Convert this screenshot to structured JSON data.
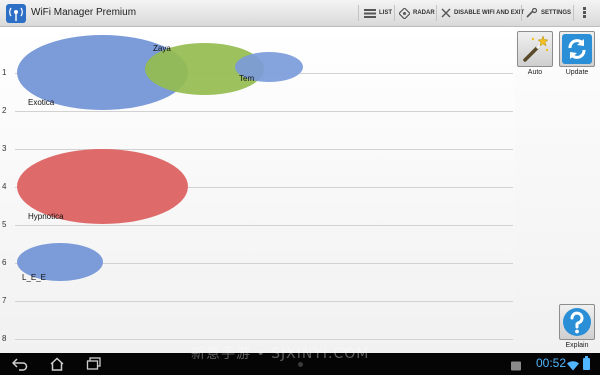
{
  "app": {
    "title": "WiFi Manager Premium",
    "icon": "wifi-antenna-icon"
  },
  "toolbar": {
    "actions": [
      {
        "label": "LIST",
        "icon": "list-icon"
      },
      {
        "label": "RADAR",
        "icon": "radar-icon"
      },
      {
        "label": "DISABLE WIFI AND EXIT",
        "icon": "disable-wifi-icon"
      },
      {
        "label": "SETTINGS",
        "icon": "wrench-icon"
      }
    ],
    "overflow_icon": "overflow-menu-icon"
  },
  "chart_data": {
    "type": "bubble",
    "y_ticks": [
      "1",
      "2",
      "3",
      "4",
      "5",
      "6",
      "7",
      "8"
    ],
    "series": [
      {
        "name": "Exotica",
        "x": 0.17,
        "y": 1.0,
        "size": 1.0,
        "color": "#7b9bd9"
      },
      {
        "name": "Zaya",
        "x": 0.37,
        "y": 0.9,
        "size": 0.7,
        "color": "#94bc4f"
      },
      {
        "name": "Tem",
        "x": 0.52,
        "y": 0.9,
        "size": 0.4,
        "color": "#7b9bd9"
      },
      {
        "name": "Hypnotica",
        "x": 0.2,
        "y": 4.0,
        "size": 1.0,
        "color": "#df6a6a"
      },
      {
        "name": "L_E_E",
        "x": 0.1,
        "y": 6.0,
        "size": 0.5,
        "color": "#7b9bd9"
      }
    ]
  },
  "side": {
    "auto_label": "Auto",
    "update_label": "Update",
    "explain_label": "Explain"
  },
  "statusbar": {
    "time": "00:52",
    "watermark": "新意手游 • SJXINYI.COM"
  }
}
